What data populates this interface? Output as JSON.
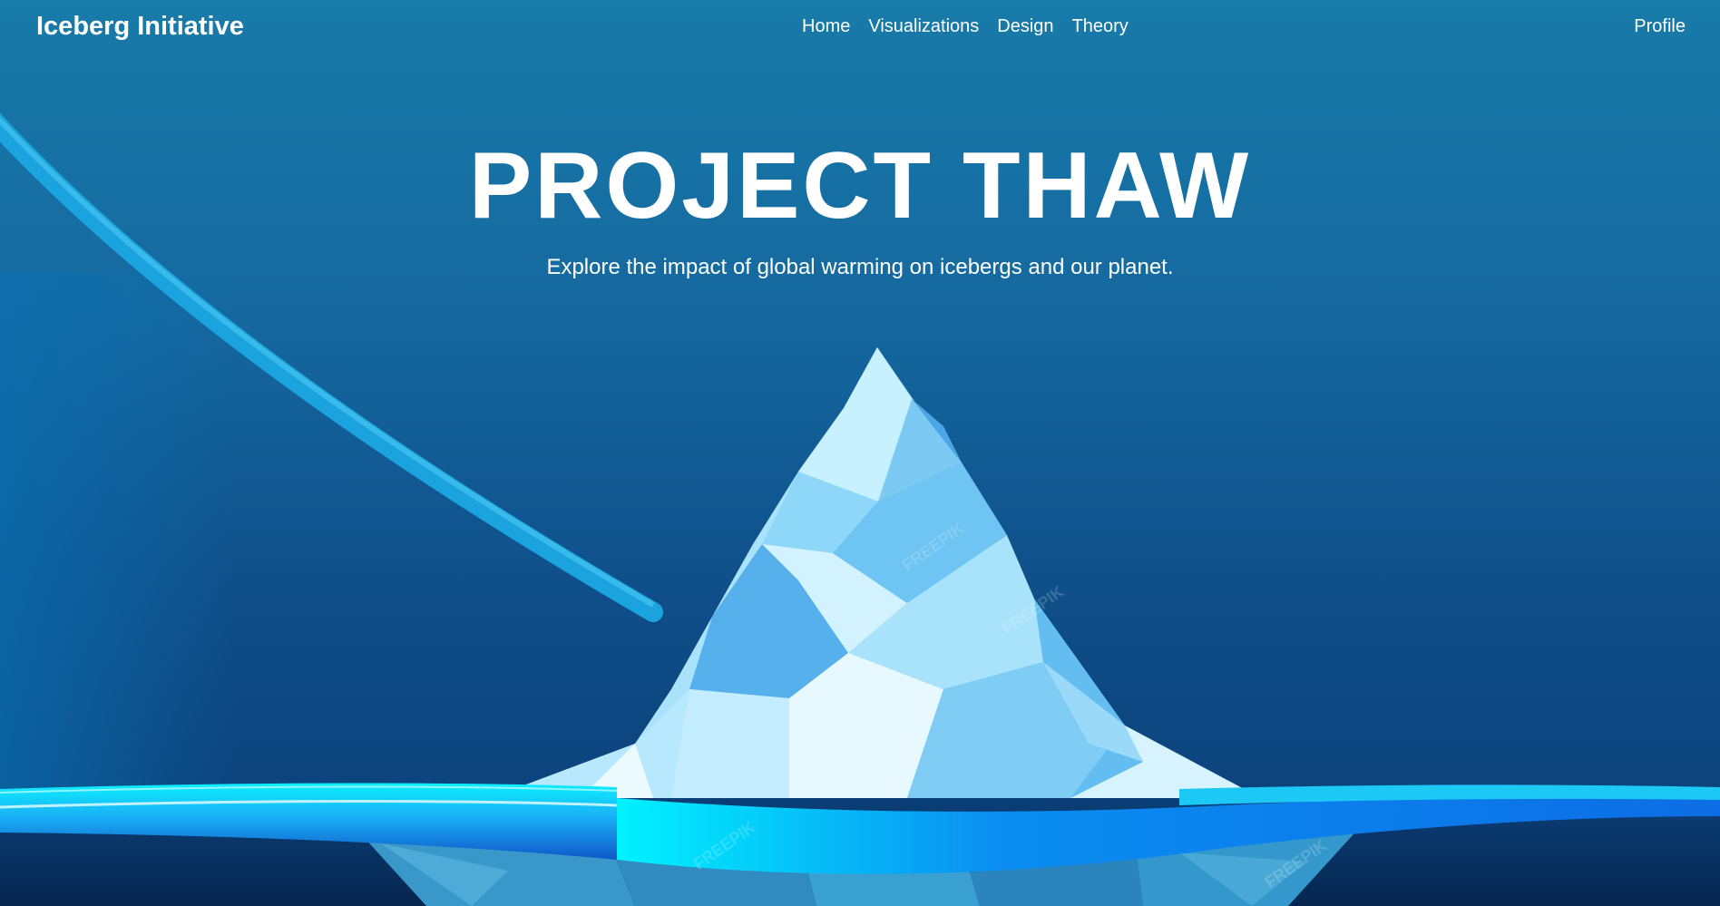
{
  "brand": {
    "name": "Iceberg Initiative"
  },
  "nav": {
    "items": [
      {
        "label": "Home"
      },
      {
        "label": "Visualizations"
      },
      {
        "label": "Design"
      },
      {
        "label": "Theory"
      }
    ],
    "profile_label": "Profile"
  },
  "hero": {
    "title": "PROJECT THAW",
    "subtitle": "Explore the impact of global warming on icebergs and our planet.",
    "illustration": "low-poly-iceberg-illustration",
    "watermark": "FREEPIK"
  },
  "colors": {
    "background_top": "#187ba9",
    "background_bottom": "#0b3c74",
    "ice_light": "#d9f4ff",
    "ice_mid": "#8fd6f7",
    "ice_dark": "#45a9e6",
    "water_cyan": "#00e9ff",
    "water_blue": "#0a7fe8",
    "text": "#ffffff"
  }
}
